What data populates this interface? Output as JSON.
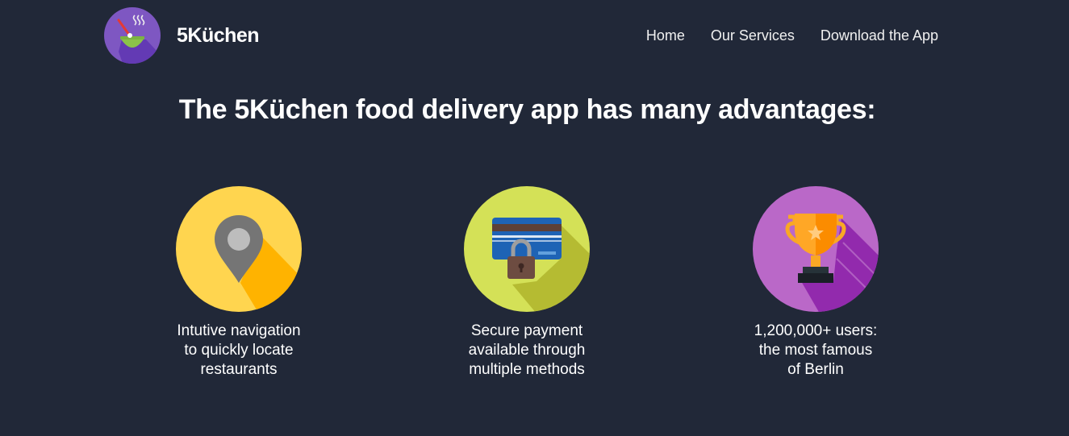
{
  "header": {
    "brand": "5Küchen",
    "nav": [
      "Home",
      "Our Services",
      "Download the App"
    ]
  },
  "main": {
    "headline": "The 5Küchen food delivery app has many advantages:",
    "features": [
      {
        "icon": "map-pin-icon",
        "lines": [
          "Intutive navigation",
          "to quickly locate",
          "restaurants"
        ]
      },
      {
        "icon": "credit-card-lock-icon",
        "lines": [
          "Secure payment",
          "available through",
          "multiple methods"
        ]
      },
      {
        "icon": "trophy-icon",
        "lines": [
          "1,200,000+ users:",
          "the most famous",
          "of Berlin"
        ]
      }
    ]
  },
  "colors": {
    "background": "#212838",
    "feature1": "#FFD54F",
    "feature2": "#D4E157",
    "feature3": "#BA68C8",
    "logo": "#7E57C2"
  }
}
